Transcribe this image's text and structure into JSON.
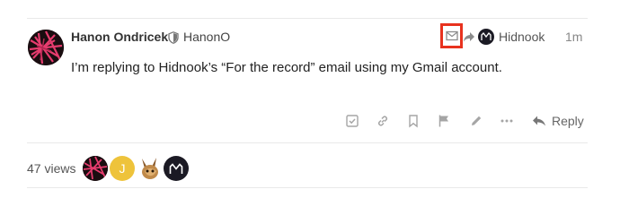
{
  "post": {
    "author_name": "Hanon Ondricek",
    "author_handle": "HanonO",
    "reply_to_name": "Hidnook",
    "time": "1m",
    "body": "I’m replying to Hidnook’s “For the record” email using my Gmail account."
  },
  "actions": {
    "reply_label": "Reply",
    "icons": [
      "check-square-icon",
      "link-icon",
      "bookmark-icon",
      "flag-icon",
      "pencil-icon",
      "more-icon",
      "reply-arrow-icon"
    ]
  },
  "footer": {
    "views_label": "47 views",
    "participant_initial": "J"
  },
  "colors": {
    "highlight_border": "#e8321e",
    "text_dark": "#222222",
    "text_muted": "#888888",
    "icon_grey": "#999999"
  }
}
